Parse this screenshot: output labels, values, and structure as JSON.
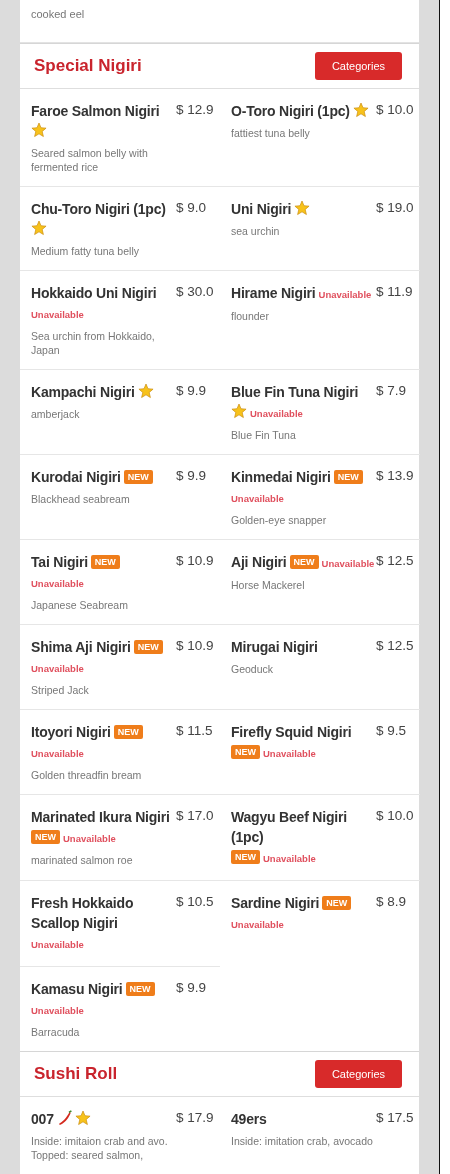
{
  "previous_section": {
    "items": [
      {
        "description": "cooked eel"
      }
    ]
  },
  "sections": [
    {
      "title": "Special Nigiri",
      "button": "Categories",
      "items": [
        {
          "name": "Faroe Salmon Nigiri",
          "price": "$ 12.9",
          "star": true,
          "description": "Seared salmon belly with fermented rice"
        },
        {
          "name": "O-Toro Nigiri (1pc)",
          "price": "$ 10.0",
          "star": true,
          "description": "fattiest tuna belly"
        },
        {
          "name": "Chu-Toro Nigiri (1pc)",
          "price": "$ 9.0",
          "star": true,
          "description": "Medium fatty tuna belly"
        },
        {
          "name": "Uni Nigiri",
          "price": "$ 19.0",
          "star": true,
          "description": "sea urchin"
        },
        {
          "name": "Hokkaido Uni Nigiri",
          "price": "$ 30.0",
          "star": false,
          "status": "Unavailable",
          "description": "Sea urchin from Hokkaido, Japan"
        },
        {
          "name": "Hirame Nigiri",
          "price": "$ 11.9",
          "star": false,
          "status": "Unavailable",
          "description": "flounder"
        },
        {
          "name": "Kampachi Nigiri",
          "price": "$ 9.9",
          "star": true,
          "description": "amberjack"
        },
        {
          "name": "Blue Fin Tuna Nigiri",
          "price": "$ 7.9",
          "star": true,
          "status": "Unavailable",
          "description": "Blue Fin Tuna"
        },
        {
          "name": "Kurodai Nigiri",
          "price": "$ 9.9",
          "star": false,
          "badge": "NEW",
          "description": "Blackhead seabream"
        },
        {
          "name": "Kinmedai Nigiri",
          "price": "$ 13.9",
          "star": false,
          "badge": "NEW",
          "status": "Unavailable",
          "description": "Golden-eye snapper"
        },
        {
          "name": "Tai Nigiri",
          "price": "$ 10.9",
          "star": false,
          "badge": "NEW",
          "status": "Unavailable",
          "description": "Japanese Seabream"
        },
        {
          "name": "Aji Nigiri",
          "price": "$ 12.5",
          "star": false,
          "badge": "NEW",
          "status": "Unavailable",
          "description": "Horse Mackerel"
        },
        {
          "name": "Shima Aji Nigiri",
          "price": "$ 10.9",
          "star": false,
          "badge": "NEW",
          "status": "Unavailable",
          "description": "Striped Jack"
        },
        {
          "name": "Mirugai Nigiri",
          "price": "$ 12.5",
          "star": false,
          "description": "Geoduck"
        },
        {
          "name": "Itoyori Nigiri",
          "price": "$ 11.5",
          "star": false,
          "badge": "NEW",
          "status": "Unavailable",
          "description": "Golden threadfin bream"
        },
        {
          "name": "Firefly Squid Nigiri",
          "price": "$ 9.5",
          "star": false,
          "badge": "NEW",
          "status": "Unavailable"
        },
        {
          "name": "Marinated Ikura Nigiri",
          "price": "$ 17.0",
          "star": false,
          "badge": "NEW",
          "status": "Unavailable",
          "description": "marinated salmon roe"
        },
        {
          "name": "Wagyu Beef Nigiri (1pc)",
          "price": "$ 10.0",
          "star": false,
          "badge": "NEW",
          "status": "Unavailable"
        },
        {
          "name": "Fresh Hokkaido Scallop Nigiri",
          "price": "$ 10.5",
          "star": false,
          "status": "Unavailable"
        },
        {
          "name": "Sardine Nigiri",
          "price": "$ 8.9",
          "star": false,
          "badge": "NEW",
          "status": "Unavailable"
        },
        {
          "name": "Kamasu Nigiri",
          "price": "$ 9.9",
          "star": false,
          "badge": "NEW",
          "status": "Unavailable",
          "description": "Barracuda"
        }
      ]
    },
    {
      "title": "Sushi Roll",
      "button": "Categories",
      "items": [
        {
          "name": "007",
          "price": "$ 17.9",
          "spicy": true,
          "star": true,
          "description": "Inside: imitaion crab and avo. Topped: seared salmon,"
        },
        {
          "name": "49ers",
          "price": "$ 17.5",
          "star": false,
          "description": "Inside: imitation crab, avocado"
        }
      ]
    }
  ]
}
